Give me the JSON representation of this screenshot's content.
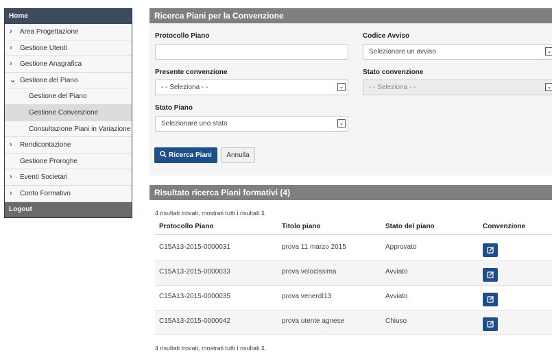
{
  "sidebar": {
    "home": "Home",
    "items": [
      {
        "label": "Area Progettazione"
      },
      {
        "label": "Gestione Utenti"
      },
      {
        "label": "Gestione Anagrafica"
      },
      {
        "label": "Gestione del Piano"
      },
      {
        "label": "Gestione del Piano"
      },
      {
        "label": "Gestione Convenzione"
      },
      {
        "label": "Consultazione Piani in Variazione"
      },
      {
        "label": "Rendicontazione"
      },
      {
        "label": "Gestione Proroghe"
      },
      {
        "label": "Eventi Societari"
      },
      {
        "label": "Conto Formativo"
      }
    ],
    "logout": "Logout"
  },
  "search": {
    "title": "Ricerca Piani per la Convenzione",
    "protocollo_label": "Protocollo Piano",
    "protocollo_value": "",
    "codice_label": "Codice Avviso",
    "codice_value": "Selezionare un avviso",
    "presente_label": "Presente convenzione",
    "presente_value": "- - Seleziona - -",
    "stato_conv_label": "Stato convenzione",
    "stato_conv_value": "- - Seleziona - -",
    "stato_piano_label": "Stato Piano",
    "stato_piano_value": "Selezionare uno stato",
    "search_button": "Ricerca Piani",
    "cancel_button": "Annulla"
  },
  "results": {
    "title": "Risultato ricerca Piani formativi (4)",
    "summary_prefix": "4 risultati trovati, mostrati tutti i risultati.",
    "summary_page": "1",
    "columns": [
      "Protocollo Piano",
      "Titolo piano",
      "Stato del piano",
      "Convenzione"
    ],
    "rows": [
      {
        "protocollo": "C15A13-2015-0000031",
        "titolo": "prova 11 marzo 2015",
        "stato": "Approvato"
      },
      {
        "protocollo": "C15A13-2015-0000033",
        "titolo": "prova velocissima",
        "stato": "Avviato"
      },
      {
        "protocollo": "C15A13-2015-0000035",
        "titolo": "prova venerdì13",
        "stato": "Avviato"
      },
      {
        "protocollo": "C15A13-2015-0000042",
        "titolo": "prova utente agnese",
        "stato": "Chiuso"
      }
    ]
  },
  "colors": {
    "primary": "#1f4f8a",
    "panel_header": "#7f7f7f",
    "sidebar_head": "#3d4a5f"
  },
  "icons": {
    "chevron": "chevron-right-icon",
    "chevron_open": "chevron-down-icon",
    "search": "search-icon",
    "edit": "edit-icon"
  }
}
